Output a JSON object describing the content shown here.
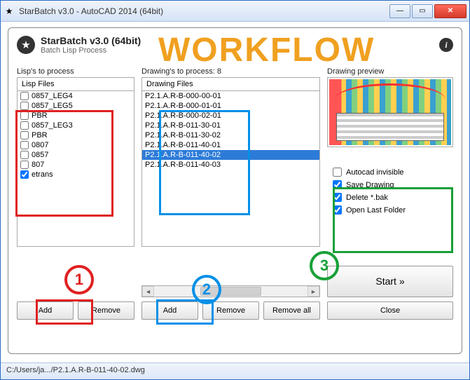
{
  "window": {
    "title": "StarBatch v3.0 - AutoCAD 2014 (64bit)"
  },
  "panel": {
    "title": "StarBatch v3.0 (64bit)",
    "subtitle": "Batch Lisp Process"
  },
  "overlay": {
    "workflow": "WORKFLOW"
  },
  "lisp": {
    "section_label": "Lisp's to process",
    "header": "Lisp Files",
    "items": [
      {
        "label": "0857_LEG4",
        "checked": false
      },
      {
        "label": "0857_LEG5",
        "checked": false
      },
      {
        "label": "PBR",
        "checked": false
      },
      {
        "label": "0857_LEG3",
        "checked": false
      },
      {
        "label": "PBR",
        "checked": false
      },
      {
        "label": "0807",
        "checked": false
      },
      {
        "label": "0857",
        "checked": false
      },
      {
        "label": "807",
        "checked": false
      },
      {
        "label": "etrans",
        "checked": true
      }
    ],
    "add": "Add",
    "remove": "Remove"
  },
  "drawings": {
    "section_label": "Drawing's to process: 8",
    "header": "Drawing Files",
    "items": [
      {
        "label": "P2.1.A.R-B-000-00-01",
        "selected": false
      },
      {
        "label": "P2.1.A.R-B-000-01-01",
        "selected": false
      },
      {
        "label": "P2.1.A.R-B-000-02-01",
        "selected": false
      },
      {
        "label": "P2.1.A.R-B-011-30-01",
        "selected": false
      },
      {
        "label": "P2.1.A.R-B-011-30-02",
        "selected": false
      },
      {
        "label": "P2.1.A.R-B-011-40-01",
        "selected": false
      },
      {
        "label": "P2.1.A.R-B-011-40-02",
        "selected": true
      },
      {
        "label": "P2.1.A.R-B-011-40-03",
        "selected": false
      }
    ],
    "add": "Add",
    "remove": "Remove",
    "remove_all": "Remove all"
  },
  "preview": {
    "section_label": "Drawing preview"
  },
  "options": {
    "items": [
      {
        "label": "Autocad invisible",
        "checked": false
      },
      {
        "label": "Save Drawing",
        "checked": true
      },
      {
        "label": "Delete *.bak",
        "checked": true
      },
      {
        "label": "Open Last Folder",
        "checked": true
      }
    ]
  },
  "buttons": {
    "start": "Start »",
    "close": "Close"
  },
  "status": {
    "path": "C:/Users/ja.../P2.1.A.R-B-011-40-02.dwg"
  },
  "anno": {
    "n1": "1",
    "n2": "2",
    "n3": "3"
  }
}
